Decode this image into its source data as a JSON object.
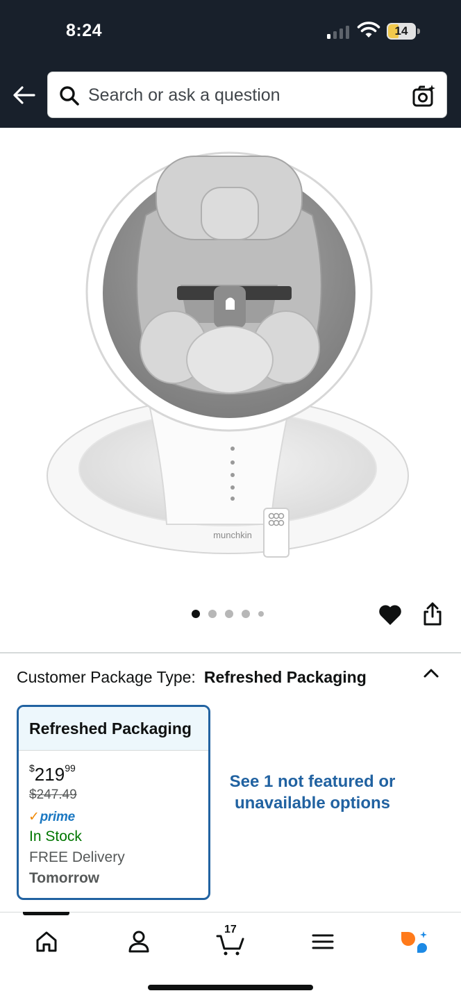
{
  "status_bar": {
    "time": "8:24",
    "battery": "14"
  },
  "search": {
    "placeholder": "Search or ask a question"
  },
  "product": {
    "image_brand_text": "munchkin",
    "carousel": {
      "count": 5,
      "active_index": 0
    }
  },
  "variant": {
    "label": "Customer Package Type:",
    "selected": "Refreshed Packaging"
  },
  "option_card": {
    "title": "Refreshed Packaging",
    "price_symbol": "$",
    "price_whole": "219",
    "price_fraction": "99",
    "list_price": "$247.49",
    "prime_label": "prime",
    "stock": "In Stock",
    "delivery": "FREE Delivery",
    "delivery_date": "Tomorrow"
  },
  "unavailable_link": "See 1 not featured or unavailable options",
  "tabbar": {
    "active_tab": "home",
    "cart_count": "17",
    "tabs": [
      "home-icon",
      "account-icon",
      "cart-icon",
      "menu-icon",
      "rufus-icon"
    ]
  },
  "colors": {
    "header_bg": "#18202b",
    "link_blue": "#2162a1",
    "stock_green": "#007600",
    "prime_blue": "#1b78c2",
    "prime_check_orange": "#f08804"
  }
}
